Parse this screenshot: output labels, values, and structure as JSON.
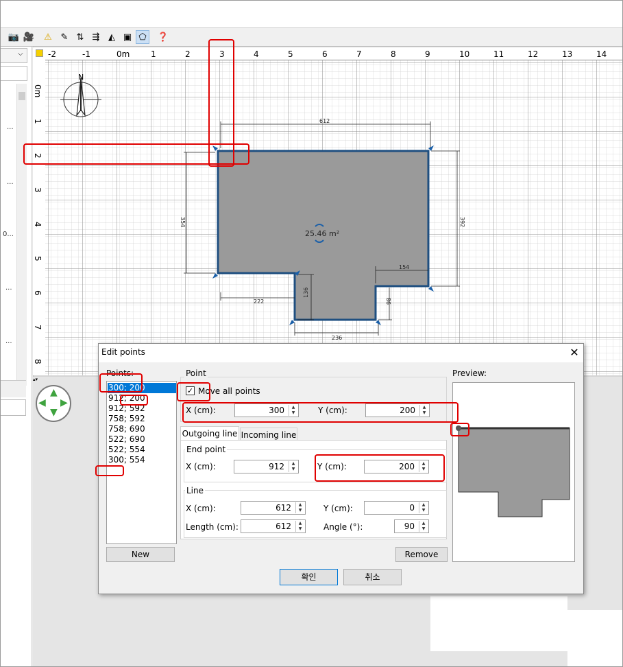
{
  "toolbar": {
    "icons": [
      "camera-icon",
      "video-camera-icon",
      "warning-icon",
      "edit-icon",
      "text-icon",
      "align-icon",
      "mirror-icon",
      "text-box-icon",
      "edit-points-icon",
      "help-icon"
    ]
  },
  "rulers": {
    "horizontal": [
      "-2",
      "-1",
      "0m",
      "1",
      "2",
      "3",
      "4",
      "5",
      "6",
      "7",
      "8",
      "9",
      "10",
      "11",
      "12",
      "13",
      "14"
    ],
    "vertical": [
      "0m",
      "1",
      "2",
      "3",
      "4",
      "5",
      "6",
      "7",
      "8"
    ]
  },
  "plan": {
    "area_label": "25.46 m²",
    "dim_top": "612",
    "dim_left": "354",
    "dim_right": "392",
    "dim_step_bottom_left": "222",
    "dim_notch_height": "136",
    "dim_bottom": "236",
    "dim_notch_right_width": "154",
    "dim_notch_right_height": "98",
    "compass_label": "N"
  },
  "left_panel": {
    "dots": [
      "...",
      "...",
      "0...",
      "...",
      "..."
    ]
  },
  "dialog": {
    "title": "Edit points",
    "points_label": "Points:",
    "points": [
      "300; 200",
      "912; 200",
      "912; 592",
      "758; 592",
      "758; 690",
      "522; 690",
      "522; 554",
      "300; 554"
    ],
    "selected_index": 0,
    "point_group_label": "Point",
    "move_all_points_label": "Move all points",
    "move_all_checked": true,
    "x_label": "X (cm):",
    "x_value": "300",
    "y_label": "Y (cm):",
    "y_value": "200",
    "tab_outgoing": "Outgoing line",
    "tab_incoming": "Incoming line",
    "end_point_label": "End point",
    "end_x_label": "X (cm):",
    "end_x_value": "912",
    "end_y_label": "Y (cm):",
    "end_y_value": "200",
    "line_label": "Line",
    "line_x_label": "X (cm):",
    "line_x_value": "612",
    "line_y_label": "Y (cm):",
    "line_y_value": "0",
    "length_label": "Length (cm):",
    "length_value": "612",
    "angle_label": "Angle (°):",
    "angle_value": "90",
    "preview_label": "Preview:",
    "new_button": "New",
    "remove_button": "Remove",
    "ok_button": "확인",
    "cancel_button": "취소"
  },
  "colors": {
    "room_fill": "#9a9a9a",
    "room_border": "#1f4f80",
    "selection": "#0078d7",
    "highlight": "#e00000"
  }
}
